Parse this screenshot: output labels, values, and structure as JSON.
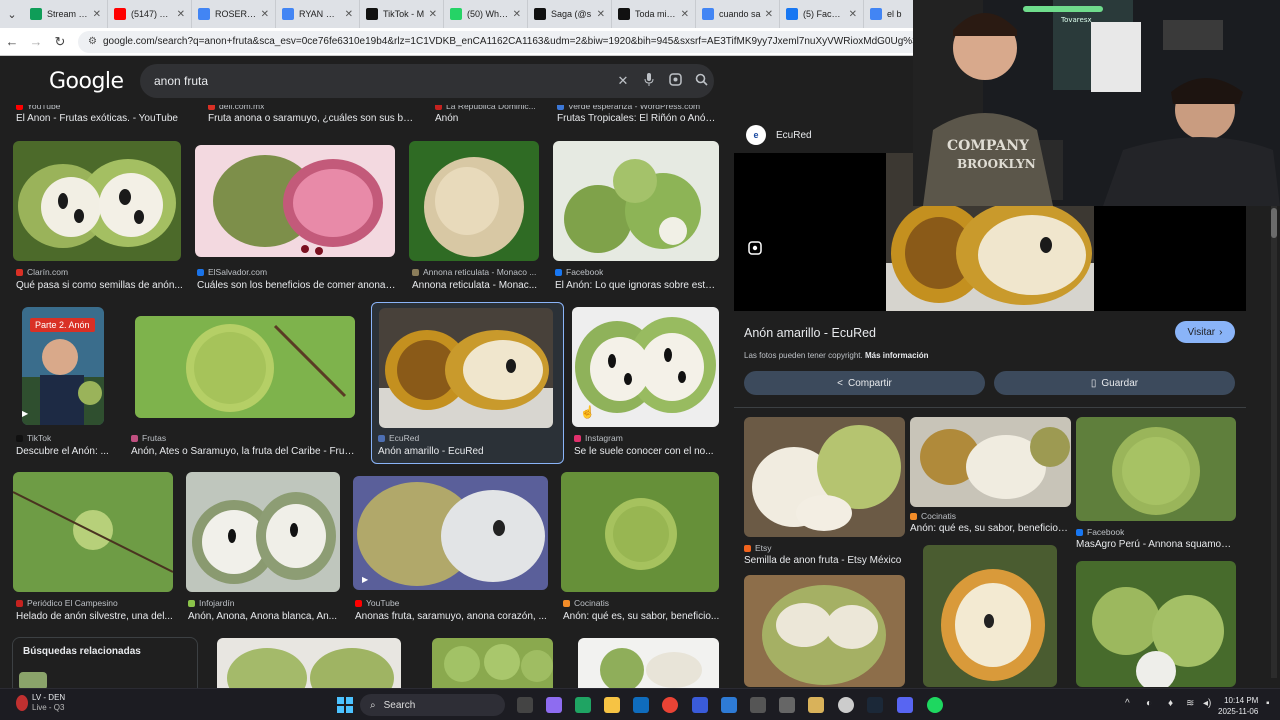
{
  "browser": {
    "tabs": [
      {
        "label": "Stream - K",
        "color": "#0f9d58"
      },
      {
        "label": "(5147) You",
        "color": "#ff0000"
      },
      {
        "label": "ROSERITO",
        "color": "#4285f4"
      },
      {
        "label": "RYAN CAS",
        "color": "#4285f4"
      },
      {
        "label": "TikTok - M",
        "color": "#111111"
      },
      {
        "label": "(50) Whats",
        "color": "#25d366"
      },
      {
        "label": "Saga (@s",
        "color": "#111111"
      },
      {
        "label": "Toda mi cu",
        "color": "#111111"
      },
      {
        "label": "cuando sa",
        "color": "#4285f4"
      },
      {
        "label": "(5) Facebo",
        "color": "#1877f2"
      },
      {
        "label": "el b",
        "color": "#4285f4"
      }
    ],
    "url": "google.com/search?q=anon+fruta&sca_esv=0ce76fe6310e19b4&rlz=1C1VDKB_enCA1162CA1163&udm=2&biw=1920&bih=945&sxsrf=AE3TifMK9yy7Jxeml7nuXyVWRioxMdG0Ug%3A1762485208"
  },
  "google": {
    "logo": "Google",
    "query": "anon fruta"
  },
  "top_row": [
    {
      "source": "YouTube",
      "title": "El Anon - Frutas exóticas. - YouTube"
    },
    {
      "source": "deli.com.mx",
      "title": "Fruta anona o saramuyo, ¿cuáles son sus ben..."
    },
    {
      "source": "La República Dominic...",
      "title": "Anón"
    },
    {
      "source": "Verde esperanza - WordPress.com",
      "title": "Frutas Tropicales: El Riñón o Anón..."
    }
  ],
  "row1": [
    {
      "source": "Clarín.com",
      "title": "Qué pasa si como semillas de anón..."
    },
    {
      "source": "ElSalvador.com",
      "title": "Cuáles son los beneficios de comer anonas..."
    },
    {
      "source": "Annona reticulata - Monaco ...",
      "title": "Annona reticulata - Monac..."
    },
    {
      "source": "Facebook",
      "title": "El Anón: Lo que ignoras sobre esta..."
    }
  ],
  "row2": [
    {
      "source": "TikTok",
      "title": "Descubre el Anón: ...",
      "badge": "Parte 2. Anón"
    },
    {
      "source": "Frutas",
      "title": "Anón, Ates o Saramuyo, la fruta del Caribe - Fruta ..."
    },
    {
      "source": "EcuRed",
      "title": "Anón amarillo - EcuRed"
    },
    {
      "source": "Instagram",
      "title": "Se le suele conocer con el no..."
    }
  ],
  "row3": [
    {
      "source": "Periódico El Campesino",
      "title": "Helado de anón silvestre, una del..."
    },
    {
      "source": "Infojardín",
      "title": "Anón, Anona, Anona blanca, An..."
    },
    {
      "source": "YouTube",
      "title": "Anonas fruta, saramuyo, anona corazón, ..."
    },
    {
      "source": "Cocinatis",
      "title": "Anón: qué es, su sabor, beneficio..."
    }
  ],
  "related_searches": {
    "title": "Búsquedas relacionadas"
  },
  "panel": {
    "source": "EcuRed",
    "title": "Anón amarillo - EcuRed",
    "visit_label": "Visitar",
    "copyright_text": "Las fotos pueden tener copyright.",
    "copyright_link": "Más información",
    "share_label": "Compartir",
    "save_label": "Guardar",
    "related": [
      {
        "source": "Etsy",
        "title": "Semilla de anon fruta - Etsy México"
      },
      {
        "source": "Cocinatis",
        "title": "Anón: qué es, su sabor, beneficios ..."
      },
      {
        "source": "Facebook",
        "title": "MasAgro Perú - Annona squamosa..."
      }
    ]
  },
  "webcam": {
    "overlay": "Tovaresx",
    "shirt_text": "COMPANY BROOKLYN"
  },
  "taskbar": {
    "match": "LV - DEN",
    "match_status": "Live - Q3",
    "search_label": "Search",
    "time": "10:14 PM",
    "date": "2025-11-06"
  },
  "icons": [
    "search-icon",
    "mic-icon",
    "lens-icon",
    "close-icon",
    "share-icon",
    "bookmark-icon",
    "play-icon",
    "windows-start-icon"
  ]
}
